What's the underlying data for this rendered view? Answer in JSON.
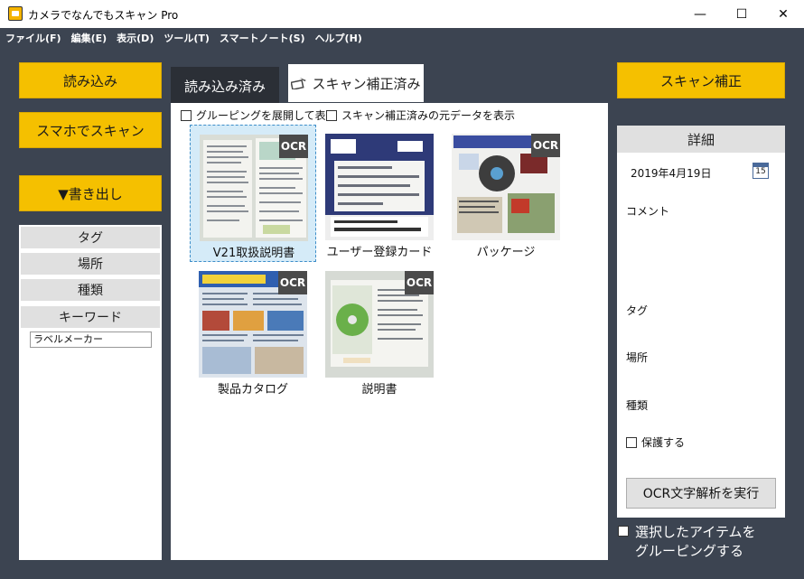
{
  "window": {
    "title": "カメラでなんでもスキャン Pro",
    "minimize": "—",
    "maximize": "☐",
    "close": "✕"
  },
  "menu": [
    "ファイル(F)",
    "編集(E)",
    "表示(D)",
    "ツール(T)",
    "スマートノート(S)",
    "ヘルプ(H)"
  ],
  "left": {
    "import_label": "読み込み",
    "phone_scan_label": "スマホでスキャン",
    "export_label": "▼書き出し",
    "filters": [
      "タグ",
      "場所",
      "種類",
      "キーワード"
    ],
    "keyword_value": "ラベルメーカー"
  },
  "tabs": {
    "loaded": "読み込み済み",
    "scanned": "スキャン補正済み"
  },
  "options": {
    "expand_grouping": "グルーピングを展開して表示",
    "show_original": "スキャン補正済みの元データを表示"
  },
  "items": [
    {
      "caption": "V21取扱説明書",
      "ocr": "OCR"
    },
    {
      "caption": "ユーザー登録カード",
      "ocr": ""
    },
    {
      "caption": "パッケージ",
      "ocr": "OCR"
    },
    {
      "caption": "製品カタログ",
      "ocr": "OCR"
    },
    {
      "caption": "説明書",
      "ocr": "OCR"
    }
  ],
  "right": {
    "scan_correct_label": "スキャン補正",
    "details_title": "詳細",
    "date": "2019年4月19日",
    "calendar_day": "15",
    "comment_label": "コメント",
    "tag_label": "タグ",
    "place_label": "場所",
    "type_label": "種類",
    "protect_label": "保護する",
    "ocr_button": "OCR文字解析を実行",
    "group_line1": "選択したアイテムを",
    "group_line2": "グルーピングする"
  },
  "colors": {
    "background": "#3c4451",
    "accent_yellow": "#f5c000",
    "active_tab": "#2b2f36"
  }
}
